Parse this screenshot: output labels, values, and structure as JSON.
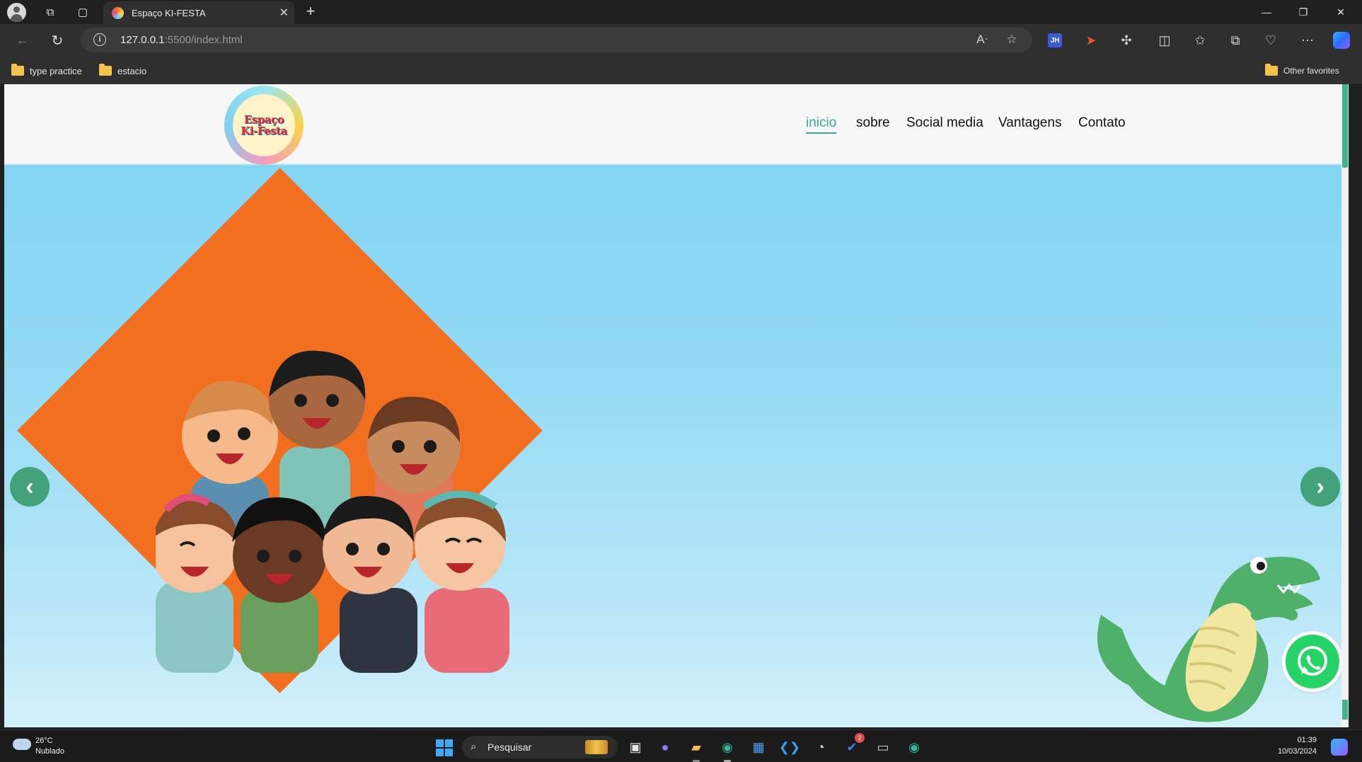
{
  "browser": {
    "tab_title": "Espaço KI-FESTA",
    "url_host": "127.0.0.1",
    "url_rest": ":5500/index.html",
    "bookmarks": [
      "type practice",
      "estacio"
    ],
    "other_favorites": "Other favorites",
    "extension_jh": "JH"
  },
  "site": {
    "logo_line1": "Espaço",
    "logo_line2": "Ki-Festa",
    "nav": [
      "inicio",
      "sobre",
      "Social media",
      "Vantagens",
      "Contato"
    ],
    "active_nav": "inicio",
    "slider_prev": "‹",
    "slider_next": "›",
    "colors": {
      "accent": "#3aa89a",
      "diamond": "#f26f1f",
      "arrow": "#44a27b",
      "sky": "#8fd9f4",
      "whatsapp": "#25d366"
    }
  },
  "taskbar": {
    "temperature": "26°C",
    "weather": "Nublado",
    "search_placeholder": "Pesquisar",
    "time": "01:39",
    "date": "10/03/2024",
    "badge_count": "2"
  }
}
